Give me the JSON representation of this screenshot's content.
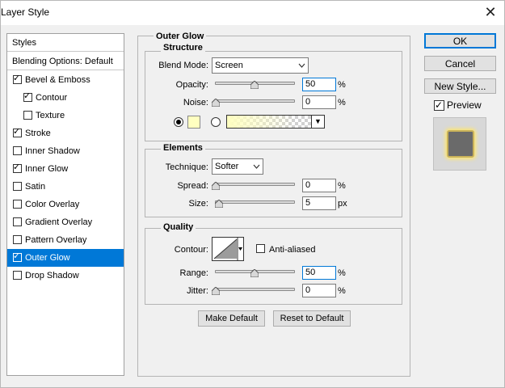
{
  "window": {
    "title": "Layer Style"
  },
  "left_panel": {
    "header": "Styles",
    "blending": "Blending Options: Default",
    "items": [
      {
        "label": "Bevel & Emboss",
        "checked": true,
        "sub": false
      },
      {
        "label": "Contour",
        "checked": true,
        "sub": true
      },
      {
        "label": "Texture",
        "checked": false,
        "sub": true
      },
      {
        "label": "Stroke",
        "checked": true,
        "sub": false
      },
      {
        "label": "Inner Shadow",
        "checked": false,
        "sub": false
      },
      {
        "label": "Inner Glow",
        "checked": true,
        "sub": false
      },
      {
        "label": "Satin",
        "checked": false,
        "sub": false
      },
      {
        "label": "Color Overlay",
        "checked": false,
        "sub": false
      },
      {
        "label": "Gradient Overlay",
        "checked": false,
        "sub": false
      },
      {
        "label": "Pattern Overlay",
        "checked": false,
        "sub": false
      },
      {
        "label": "Outer Glow",
        "checked": true,
        "sub": false,
        "selected": true
      },
      {
        "label": "Drop Shadow",
        "checked": false,
        "sub": false
      }
    ]
  },
  "panel": {
    "title": "Outer Glow",
    "structure": {
      "label": "Structure",
      "blend_mode_label": "Blend Mode:",
      "blend_mode_value": "Screen",
      "opacity_label": "Opacity:",
      "opacity_value": "50",
      "noise_label": "Noise:",
      "noise_value": "0",
      "unit_percent": "%",
      "glow_color": "#ffffc0"
    },
    "elements": {
      "label": "Elements",
      "technique_label": "Technique:",
      "technique_value": "Softer",
      "spread_label": "Spread:",
      "spread_value": "0",
      "size_label": "Size:",
      "size_value": "5",
      "unit_percent": "%",
      "unit_px": "px"
    },
    "quality": {
      "label": "Quality",
      "contour_label": "Contour:",
      "anti_aliased_label": "Anti-aliased",
      "range_label": "Range:",
      "range_value": "50",
      "jitter_label": "Jitter:",
      "jitter_value": "0",
      "unit_percent": "%"
    },
    "make_default": "Make Default",
    "reset_default": "Reset to Default"
  },
  "right": {
    "ok": "OK",
    "cancel": "Cancel",
    "new_style": "New Style...",
    "preview_label": "Preview"
  },
  "icons": {
    "close": "close-icon"
  },
  "colors": {
    "accent": "#0078d7",
    "selection": "#0078d7"
  }
}
